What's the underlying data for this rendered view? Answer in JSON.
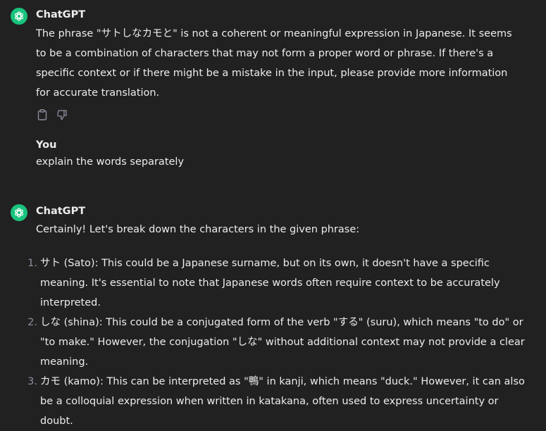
{
  "messages": [
    {
      "author": "ChatGPT",
      "text": "The phrase \"サトしなカモと\" is not a coherent or meaningful expression in Japanese. It seems to be a combination of characters that may not form a proper word or phrase. If there's a specific context or if there might be a mistake in the input, please provide more information for accurate translation."
    },
    {
      "author": "You",
      "text": "explain the words separately"
    },
    {
      "author": "ChatGPT",
      "intro": "Certainly! Let's break down the characters in the given phrase:",
      "items": [
        {
          "num": "1.",
          "text": "サト (Sato): This could be a Japanese surname, but on its own, it doesn't have a specific meaning. It's essential to note that Japanese words often require context to be accurately interpreted."
        },
        {
          "num": "2.",
          "text": "しな (shina): This could be a conjugated form of the verb \"する\" (suru), which means \"to do\" or \"to make.\" However, the conjugation \"しな\" without additional context may not provide a clear meaning."
        },
        {
          "num": "3.",
          "text": "カモ (kamo): This can be interpreted as \"鴨\" in kanji, which means \"duck.\" However, it can also be a colloquial expression when written in katakana, often used to express uncertainty or doubt."
        }
      ]
    }
  ],
  "icons": {
    "avatar": "openai-logo-icon",
    "copy": "clipboard-icon",
    "dislike": "thumbs-down-icon"
  },
  "colors": {
    "background": "#212121",
    "text": "#ececec",
    "avatar": "#19c37d",
    "muted": "#8e8ea0"
  }
}
